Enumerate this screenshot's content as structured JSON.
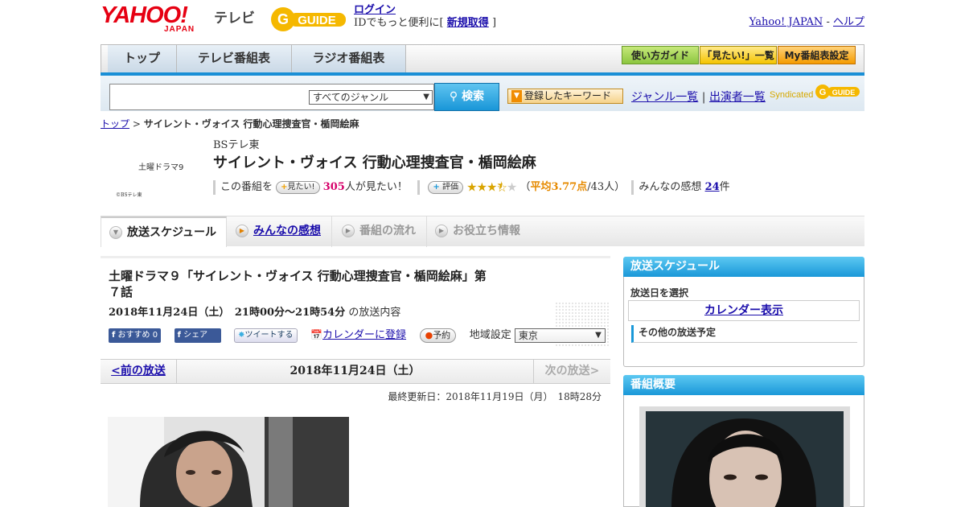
{
  "header": {
    "yahoo_logo": "YAHOO!",
    "yahoo_japan": "JAPAN",
    "tv_label": "テレビ",
    "gguide_logo": "GUIDE",
    "login_link": "ログイン",
    "login_text": "IDでもっと便利に[",
    "register_link": "新規取得",
    "login_text_end": "]",
    "yahoo_japan_link": "Yahoo! JAPAN",
    "separator": "-",
    "help_link": "ヘルプ"
  },
  "nav": {
    "tabs": [
      "トップ",
      "テレビ番組表",
      "ラジオ番組表"
    ],
    "guide_buttons": [
      "使い方ガイド",
      "「見たい!」一覧",
      "My番組表設定"
    ]
  },
  "search": {
    "genre_select": "すべてのジャンル",
    "search_button": "検索",
    "keyword_button": "登録したキーワード",
    "genre_list_link": "ジャンル一覧",
    "divider": "|",
    "performer_link": "出演者一覧",
    "syndicated": "Syndicated"
  },
  "breadcrumb": {
    "top": "トップ",
    "sep": ">",
    "current": "サイレント・ヴォイス 行動心理捜査官・楯岡絵麻"
  },
  "program": {
    "logo_text": "土曜ドラマ9",
    "logo_credit": "©BSテレ東",
    "channel": "BSテレ東",
    "title": "サイレント・ヴォイス 行動心理捜査官・楯岡絵麻",
    "want_prefix": "この番組を",
    "want_button": "見たい!",
    "want_count": "305",
    "want_suffix": "人が見たい！",
    "rating_button": "評価",
    "rating_open": "（",
    "rating_avg": "平均3.77点",
    "rating_count": "/43人）",
    "reviews_label": "みんなの感想",
    "reviews_count": "24",
    "reviews_suffix": "件"
  },
  "sub_tabs": [
    "放送スケジュール",
    "みんなの感想",
    "番組の流れ",
    "お役立ち情報"
  ],
  "episode": {
    "title": "土曜ドラマ９「サイレント・ヴォイス 行動心理捜査官・楯岡絵麻」第７話",
    "date": "2018年11月24日（土）　21時00分～21時54分",
    "date_suffix": "の放送内容",
    "recommend_button": "おすすめ 0",
    "share_button": "シェア",
    "tweet_button": "ツイートする",
    "calendar_link": "カレンダーに登録",
    "reserve_button": "予約",
    "region_label": "地域設定",
    "region_value": "東京"
  },
  "pager": {
    "prev": "<前の放送",
    "current": "2018年11月24日（土）",
    "next": "次の放送>"
  },
  "updated": "最終更新日：2018年11月19日（月）　18時28分",
  "sidebar": {
    "schedule_head": "放送スケジュール",
    "schedule_label": "放送日を選択",
    "calendar_button": "カレンダー表示",
    "other_schedule": "その他の放送予定",
    "summary_head": "番組概要"
  },
  "colors": {
    "accent_blue": "#1a98d8",
    "yahoo_red": "#e60012",
    "star_gold": "#d9a400",
    "count_pink": "#d6006a"
  }
}
